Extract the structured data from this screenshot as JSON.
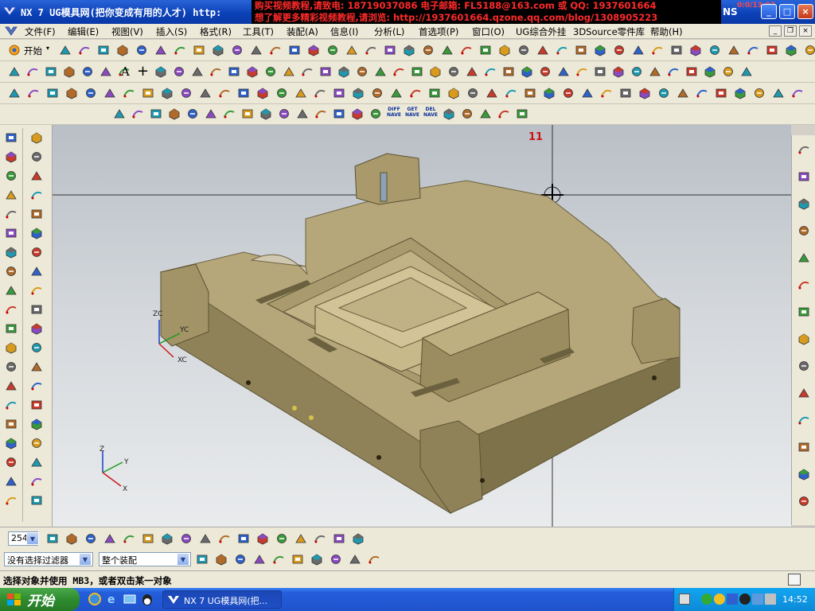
{
  "window": {
    "title": "NX 7 UG模具网(把你变成有用的人才) http:",
    "brand": "NS",
    "clock_overlay": "0:0/13:03",
    "promo_line1": "购买视频教程,请致电: 18719037086 电子邮箱: FL5188@163.com 或 QQ: 1937601664",
    "promo_line2": "想了解更多精彩视频教程,请浏览: http://1937601664.qzone.qq.com/blog/1308905223",
    "min_label": "_",
    "max_label": "□",
    "close_label": "×"
  },
  "menu": {
    "items": [
      "文件(F)",
      "编辑(E)",
      "视图(V)",
      "插入(S)",
      "格式(R)",
      "工具(T)",
      "装配(A)",
      "信息(I)",
      "分析(L)",
      "首选项(P)",
      "窗口(O)",
      "UG综合外挂",
      "3DSource零件库",
      "帮助(H)"
    ],
    "mdi_min": "_",
    "mdi_restore": "❐",
    "mdi_close": "×"
  },
  "toolbar": {
    "start_label": "开始",
    "start_arrow": "▾",
    "tool_text_a": "A",
    "tool_text_plus": "+",
    "macro_labels": [
      "DIFF NAVE",
      "GET NAVE",
      "DEL NAVE"
    ]
  },
  "viewport": {
    "annotation_number": "11",
    "wcs_labels": {
      "yc": "YC",
      "xc": "XC",
      "zc": "ZC"
    },
    "triad_labels": {
      "z": "Z",
      "y": "Y",
      "x": "X"
    }
  },
  "bottombar": {
    "layer_value": "254",
    "filter_value": "没有选择过滤器",
    "assembly_value": "整个装配"
  },
  "status": {
    "message": "选择对象并使用 MB3，或者双击某一对象"
  },
  "taskbar": {
    "start_label": "开始",
    "task_label": "NX 7 UG模具网(把...",
    "clock": "14:52"
  },
  "colors": {
    "model_top": "#b6a77b",
    "model_side": "#8f8258",
    "model_dark": "#6b613f",
    "viewport_top": "#b9bfc6",
    "viewport_bottom": "#e9ebed",
    "annotation_red": "#d01010"
  }
}
